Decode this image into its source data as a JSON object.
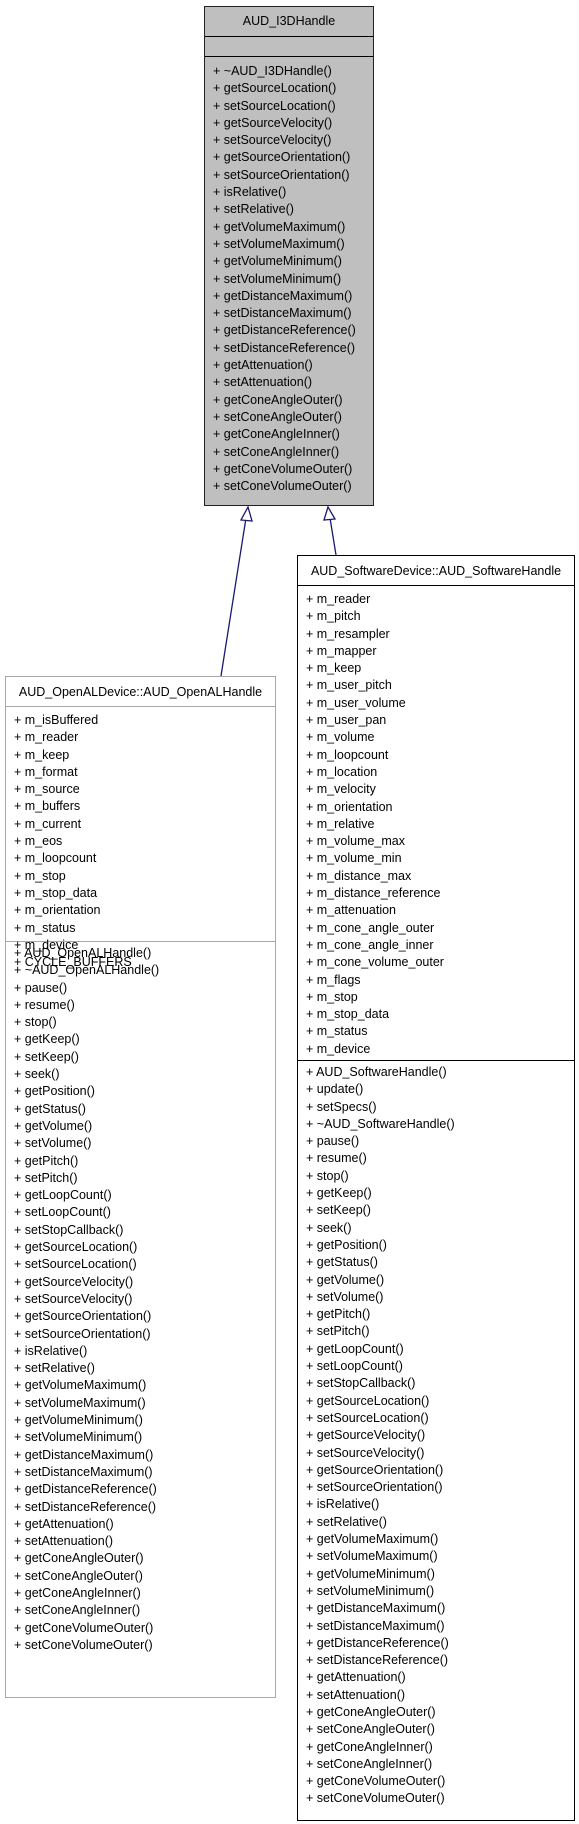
{
  "colors": {
    "base_fill": "#bfbfbf",
    "edge": "#191970",
    "gray_border": "#a8a8a8"
  },
  "base": {
    "title": "AUD_I3DHandle",
    "attributes": [],
    "methods": [
      "+ ~AUD_I3DHandle()",
      "+ getSourceLocation()",
      "+ setSourceLocation()",
      "+ getSourceVelocity()",
      "+ setSourceVelocity()",
      "+ getSourceOrientation()",
      "+ setSourceOrientation()",
      "+ isRelative()",
      "+ setRelative()",
      "+ getVolumeMaximum()",
      "+ setVolumeMaximum()",
      "+ getVolumeMinimum()",
      "+ setVolumeMinimum()",
      "+ getDistanceMaximum()",
      "+ setDistanceMaximum()",
      "+ getDistanceReference()",
      "+ setDistanceReference()",
      "+ getAttenuation()",
      "+ setAttenuation()",
      "+ getConeAngleOuter()",
      "+ setConeAngleOuter()",
      "+ getConeAngleInner()",
      "+ setConeAngleInner()",
      "+ getConeVolumeOuter()",
      "+ setConeVolumeOuter()"
    ]
  },
  "openal": {
    "title": "AUD_OpenALDevice::AUD_OpenALHandle",
    "attributes": [
      "+ m_isBuffered",
      "+ m_reader",
      "+ m_keep",
      "+ m_format",
      "+ m_source",
      "+ m_buffers",
      "+ m_current",
      "+ m_eos",
      "+ m_loopcount",
      "+ m_stop",
      "+ m_stop_data",
      "+ m_orientation",
      "+ m_status",
      "+ m_device",
      "+ CYCLE_BUFFERS"
    ],
    "methods": [
      "+ AUD_OpenALHandle()",
      "+ ~AUD_OpenALHandle()",
      "+ pause()",
      "+ resume()",
      "+ stop()",
      "+ getKeep()",
      "+ setKeep()",
      "+ seek()",
      "+ getPosition()",
      "+ getStatus()",
      "+ getVolume()",
      "+ setVolume()",
      "+ getPitch()",
      "+ setPitch()",
      "+ getLoopCount()",
      "+ setLoopCount()",
      "+ setStopCallback()",
      "+ getSourceLocation()",
      "+ setSourceLocation()",
      "+ getSourceVelocity()",
      "+ setSourceVelocity()",
      "+ getSourceOrientation()",
      "+ setSourceOrientation()",
      "+ isRelative()",
      "+ setRelative()",
      "+ getVolumeMaximum()",
      "+ setVolumeMaximum()",
      "+ getVolumeMinimum()",
      "+ setVolumeMinimum()",
      "+ getDistanceMaximum()",
      "+ setDistanceMaximum()",
      "+ getDistanceReference()",
      "+ setDistanceReference()",
      "+ getAttenuation()",
      "+ setAttenuation()",
      "+ getConeAngleOuter()",
      "+ setConeAngleOuter()",
      "+ getConeAngleInner()",
      "+ setConeAngleInner()",
      "+ getConeVolumeOuter()",
      "+ setConeVolumeOuter()"
    ]
  },
  "software": {
    "title": "AUD_SoftwareDevice::AUD_SoftwareHandle",
    "attributes": [
      "+ m_reader",
      "+ m_pitch",
      "+ m_resampler",
      "+ m_mapper",
      "+ m_keep",
      "+ m_user_pitch",
      "+ m_user_volume",
      "+ m_user_pan",
      "+ m_volume",
      "+ m_loopcount",
      "+ m_location",
      "+ m_velocity",
      "+ m_orientation",
      "+ m_relative",
      "+ m_volume_max",
      "+ m_volume_min",
      "+ m_distance_max",
      "+ m_distance_reference",
      "+ m_attenuation",
      "+ m_cone_angle_outer",
      "+ m_cone_angle_inner",
      "+ m_cone_volume_outer",
      "+ m_flags",
      "+ m_stop",
      "+ m_stop_data",
      "+ m_status",
      "+ m_device"
    ],
    "methods": [
      "+ AUD_SoftwareHandle()",
      "+ update()",
      "+ setSpecs()",
      "+ ~AUD_SoftwareHandle()",
      "+ pause()",
      "+ resume()",
      "+ stop()",
      "+ getKeep()",
      "+ setKeep()",
      "+ seek()",
      "+ getPosition()",
      "+ getStatus()",
      "+ getVolume()",
      "+ setVolume()",
      "+ getPitch()",
      "+ setPitch()",
      "+ getLoopCount()",
      "+ setLoopCount()",
      "+ setStopCallback()",
      "+ getSourceLocation()",
      "+ setSourceLocation()",
      "+ getSourceVelocity()",
      "+ setSourceVelocity()",
      "+ getSourceOrientation()",
      "+ setSourceOrientation()",
      "+ isRelative()",
      "+ setRelative()",
      "+ getVolumeMaximum()",
      "+ setVolumeMaximum()",
      "+ getVolumeMinimum()",
      "+ setVolumeMinimum()",
      "+ getDistanceMaximum()",
      "+ setDistanceMaximum()",
      "+ getDistanceReference()",
      "+ setDistanceReference()",
      "+ getAttenuation()",
      "+ setAttenuation()",
      "+ getConeAngleOuter()",
      "+ setConeAngleOuter()",
      "+ getConeAngleInner()",
      "+ setConeAngleInner()",
      "+ getConeVolumeOuter()",
      "+ setConeVolumeOuter()"
    ]
  }
}
